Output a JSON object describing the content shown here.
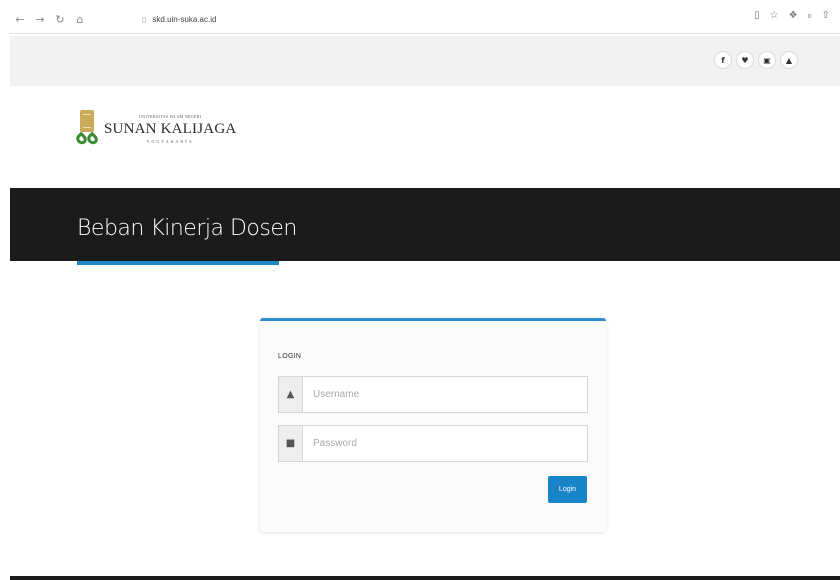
{
  "browser": {
    "url": "skd.uin-suka.ac.id",
    "nav": {
      "back_icon": "←",
      "forward_icon": "→",
      "reload_icon": "↻",
      "home_icon": "⌂",
      "lock_icon": "▯"
    },
    "right_icons": {
      "reader": "▯",
      "star": "☆",
      "extensions": "❖",
      "profile": "₀",
      "share": "⇧"
    }
  },
  "social": {
    "facebook": "f",
    "twitter": "♥",
    "instagram": "▣",
    "youtube": "▲"
  },
  "logo": {
    "top_text": "UNIVERSITAS ISLAM NEGERI",
    "main_text": "SUNAN KALIJAGA",
    "sub_text": "YOGYAKARTA"
  },
  "banner": {
    "title": "Beban Kinerja Dosen"
  },
  "login": {
    "title": "LOGIN",
    "username_placeholder": "Username",
    "password_placeholder": "Password",
    "user_icon": "▲",
    "lock_icon": "■",
    "button_label": "Login"
  },
  "colors": {
    "banner_bg": "#1b1b1b",
    "accent": "#1e88c7",
    "button": "#1985c8",
    "logo_gold": "#c9ab5a",
    "logo_green": "#3c8a32"
  }
}
